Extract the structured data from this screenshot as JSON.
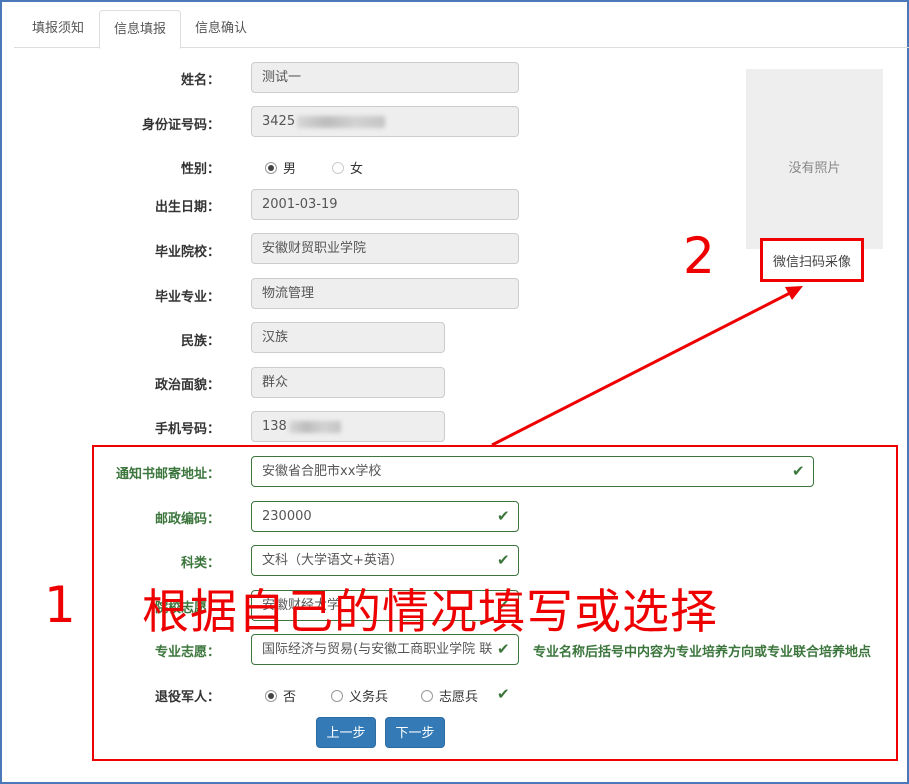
{
  "tabs": [
    "填报须知",
    "信息填报",
    "信息确认"
  ],
  "form": {
    "name_label": "姓名：",
    "name_value": "测试一",
    "id_label": "身份证号码：",
    "id_value": "3425",
    "gender_label": "性别：",
    "gender_options": [
      "男",
      "女"
    ],
    "gender_selected": "男",
    "birth_label": "出生日期：",
    "birth_value": "2001-03-19",
    "school_label": "毕业院校：",
    "school_value": "安徽财贸职业学院",
    "major_label": "毕业专业：",
    "major_value": "物流管理",
    "ethnic_label": "民族：",
    "ethnic_value": "汉族",
    "political_label": "政治面貌：",
    "political_value": "群众",
    "phone_label": "手机号码：",
    "phone_value": "138",
    "address_label": "通知书邮寄地址：",
    "address_value": "安徽省合肥市xx学校",
    "postcode_label": "邮政编码：",
    "postcode_value": "230000",
    "subject_label": "科类：",
    "subject_value": "文科（大学语文+英语）",
    "college_label": "院校志愿：",
    "college_value": "安徽财经大学",
    "major_choice_label": "专业志愿：",
    "major_choice_value": "国际经济与贸易(与安徽工商职业学院 联",
    "major_hint": "专业名称后括号中内容为专业培养方向或专业联合培养地点",
    "veteran_label": "退役军人：",
    "veteran_options": [
      "否",
      "义务兵",
      "志愿兵"
    ],
    "veteran_selected": "否"
  },
  "photo": {
    "placeholder": "没有照片",
    "wechat_button": "微信扫码采像"
  },
  "buttons": {
    "prev": "上一步",
    "next": "下一步"
  },
  "annotations": {
    "num1": "1",
    "num2": "2",
    "instruction": "根据自己的情况填写或选择"
  },
  "colors": {
    "annotation_red": "#ee0000",
    "valid_green": "#3c763d",
    "button_blue": "#337ab7"
  }
}
